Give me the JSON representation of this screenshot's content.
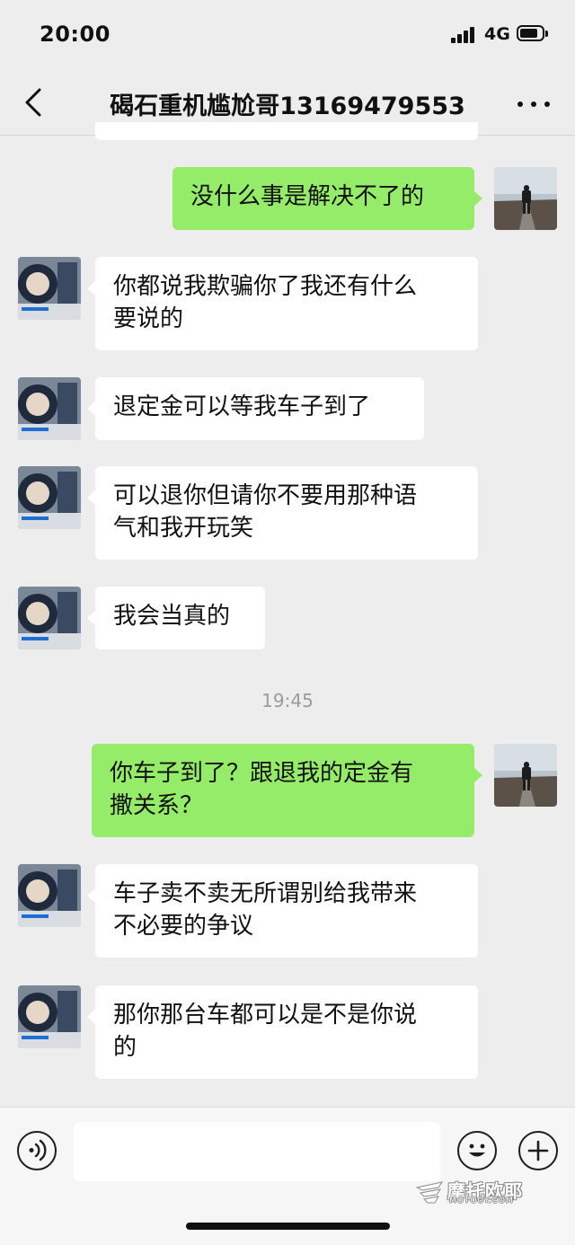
{
  "status_bar": {
    "time": "20:00",
    "network": "4G"
  },
  "nav": {
    "title": "碣石重机尴尬哥13169479553",
    "back_icon": "chevron-left-icon",
    "more_icon": "more-dots-icon"
  },
  "messages": [
    {
      "side": "out",
      "lines": [
        "没什么事是解决不了的"
      ]
    },
    {
      "side": "in",
      "lines": [
        "你都说我欺骗你了我还有什么",
        "要说的"
      ]
    },
    {
      "side": "in",
      "lines": [
        "退定金可以等我车子到了"
      ]
    },
    {
      "side": "in",
      "lines": [
        "可以退你但请你不要用那种语",
        "气和我开玩笑"
      ]
    },
    {
      "side": "in",
      "lines": [
        "我会当真的"
      ]
    },
    {
      "side": "out",
      "lines": [
        "你车子到了？跟退我的定金有",
        "撒关系？"
      ]
    },
    {
      "side": "in",
      "lines": [
        "车子卖不卖无所谓别给我带来",
        "不必要的争议"
      ]
    },
    {
      "side": "in",
      "lines": [
        "那你那台车都可以是不是你说",
        "的"
      ]
    }
  ],
  "timestamp": "19:45",
  "input_bar": {
    "voice_icon": "voice-icon",
    "emoji_icon": "emoji-icon",
    "plus_icon": "plus-icon",
    "input_value": ""
  },
  "watermark": {
    "main": "摩托欧耶",
    "sub": "MOTOOY.COM"
  },
  "colors": {
    "background": "#ededed",
    "outgoing_bubble": "#95ec69",
    "incoming_bubble": "#ffffff"
  }
}
